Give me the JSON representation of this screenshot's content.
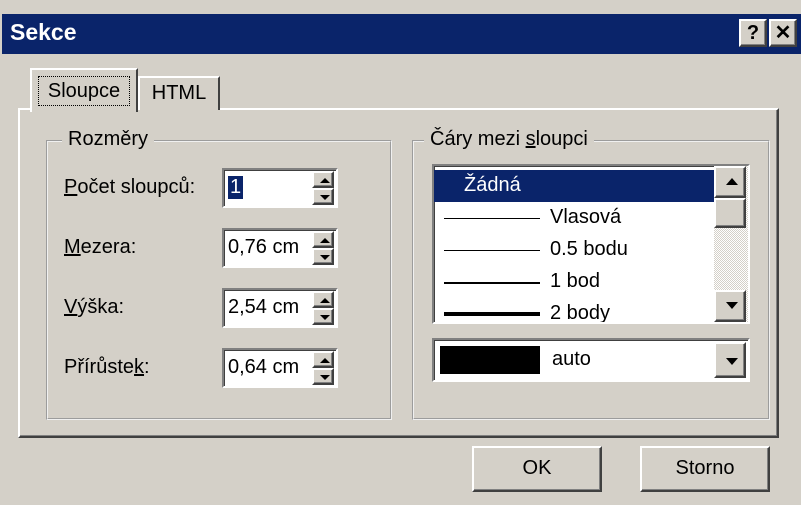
{
  "window": {
    "title": "Sekce",
    "help_label": "?",
    "close_label": "✕"
  },
  "tabs": [
    {
      "label": "Sloupce",
      "active": true
    },
    {
      "label": "HTML",
      "active": false
    }
  ],
  "dimensions": {
    "group_title": "Rozměry",
    "fields": [
      {
        "label_pre": "",
        "label_u": "P",
        "label_post": "očet sloupců:",
        "value": "1"
      },
      {
        "label_pre": "",
        "label_u": "M",
        "label_post": "ezera:",
        "value": "0,76 cm"
      },
      {
        "label_pre": "",
        "label_u": "V",
        "label_post": "ýška:",
        "value": "2,54 cm"
      },
      {
        "label_pre": "Přírůste",
        "label_u": "k",
        "label_post": ":",
        "value": "0,64 cm"
      }
    ]
  },
  "lines": {
    "group_title_pre": "Čáry mezi ",
    "group_title_u": "s",
    "group_title_post": "loupci",
    "items": [
      {
        "label": "Žádná",
        "selected": true
      },
      {
        "label": "Vlasová",
        "selected": false
      },
      {
        "label": "0.5 bodu",
        "selected": false
      },
      {
        "label": "1 bod",
        "selected": false
      },
      {
        "label": "2 body",
        "selected": false
      }
    ],
    "color": {
      "swatch": "#000000",
      "label": "auto"
    }
  },
  "buttons": {
    "ok": "OK",
    "cancel": "Storno"
  },
  "icons": [
    "question-icon",
    "close-icon",
    "spin-up-icon",
    "spin-down-icon",
    "scroll-up-icon",
    "scroll-down-icon",
    "dropdown-arrow-icon"
  ],
  "colors": {
    "titlebar": "#0a246a",
    "face": "#d4d0c8",
    "selection": "#0a246a"
  }
}
